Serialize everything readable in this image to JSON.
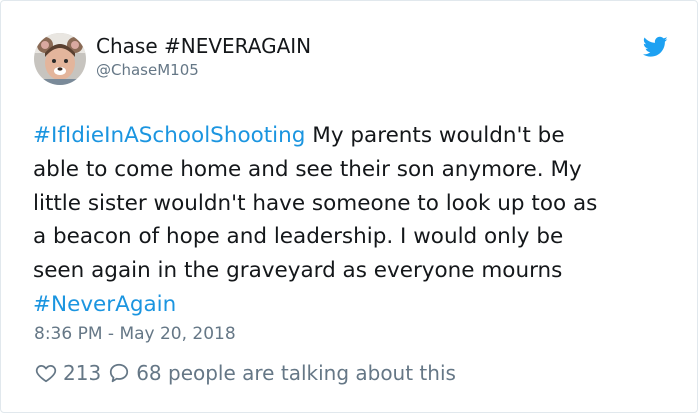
{
  "tweet": {
    "display_name": "Chase #NEVERAGAIN",
    "handle": "@ChaseM105",
    "logo_icon": "twitter-bird-icon",
    "text_lines": [
      {
        "hashtag": "#IfIdieInASchoolShooting",
        "text": " My parents wouldn't be"
      },
      {
        "text": "able to come home and see their son anymore. My"
      },
      {
        "text": "little sister wouldn't have someone to look up too as"
      },
      {
        "text": "a beacon of hope and leadership. I would only be"
      },
      {
        "text": "seen again in the graveyard as everyone mourns"
      },
      {
        "hashtag": "#NeverAgain"
      }
    ],
    "timestamp": "8:36 PM - May 20, 2018",
    "likes": "213",
    "talking": "68 people are talking about this"
  },
  "colors": {
    "link": "#1b95e0",
    "secondary_text": "#657786",
    "primary_text": "#14171a",
    "border": "#e1e8ed"
  }
}
